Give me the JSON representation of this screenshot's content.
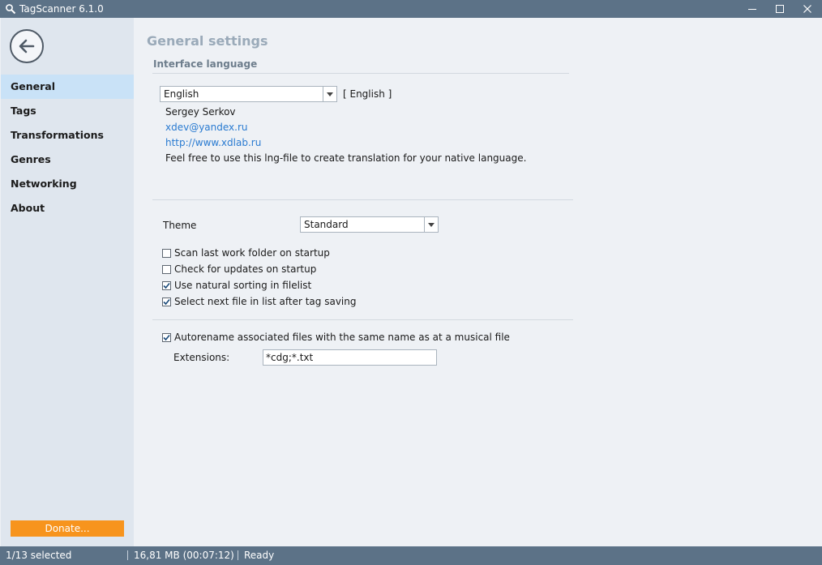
{
  "window": {
    "title": "TagScanner 6.1.0"
  },
  "sidebar": {
    "items": [
      {
        "label": "General",
        "active": true
      },
      {
        "label": "Tags"
      },
      {
        "label": "Transformations"
      },
      {
        "label": "Genres"
      },
      {
        "label": "Networking"
      },
      {
        "label": "About"
      }
    ],
    "donate_label": "Donate..."
  },
  "general": {
    "page_title": "General settings",
    "interface_language": {
      "section_title": "Interface language",
      "selected_language": "English",
      "language_code": "[ English ]",
      "author": "Sergey Serkov",
      "email": "xdev@yandex.ru",
      "website": "http://www.xdlab.ru",
      "note": "Feel free to use this lng-file to create translation for your native language."
    },
    "theme": {
      "label": "Theme",
      "value": "Standard"
    },
    "options": [
      {
        "label": "Scan last work folder on startup",
        "checked": false
      },
      {
        "label": "Check for updates on startup",
        "checked": false
      },
      {
        "label": "Use natural sorting in filelist",
        "checked": true
      },
      {
        "label": "Select next file in list after tag saving",
        "checked": true
      }
    ],
    "autorename": {
      "label": "Autorename associated files with the same name as at a musical file",
      "checked": true,
      "extensions_label": "Extensions:",
      "extensions_value": "*cdg;*.txt"
    }
  },
  "statusbar": {
    "selection": "1/13 selected",
    "size": "16,81 MB (00:07:12)",
    "state": "Ready"
  },
  "colors": {
    "titlebar": "#5c7287",
    "sidebar_bg": "#dfe6ee",
    "active_item": "#c9e2f7",
    "donate": "#f7941d",
    "link": "#2a7bd1"
  }
}
